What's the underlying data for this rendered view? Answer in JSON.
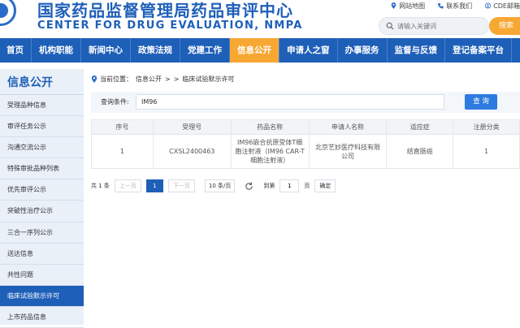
{
  "header": {
    "brand_cn": "国家药品监督管理局药品审评中心",
    "brand_en": "CENTER FOR DRUG EVALUATION, NMPA",
    "toplinks": [
      "网站地图",
      "联系我们",
      "CDE邮箱"
    ],
    "search_placeholder": "请输入关键词",
    "search_button": "搜索"
  },
  "nav": {
    "items": [
      "首页",
      "机构职能",
      "新闻中心",
      "政策法规",
      "党建工作",
      "信息公开",
      "申请人之窗",
      "办事服务",
      "监督与反馈",
      "登记备案平台"
    ],
    "active_index": 5
  },
  "sidebar": {
    "title": "信息公开",
    "items": [
      "受理品种信息",
      "审评任务公示",
      "沟通交流公示",
      "特殊审批品种列表",
      "优先审评公示",
      "突破性治疗公示",
      "三合一序列公示",
      "送达信息",
      "共性问题",
      "临床试验默示许可",
      "上市药品信息"
    ],
    "active_index": 9
  },
  "breadcrumb": {
    "prefix": "当前位置：",
    "parts": [
      "信息公开",
      ">",
      ">",
      "临床试验默示许可"
    ]
  },
  "filter": {
    "label": "查询条件:",
    "value": "IM96",
    "button": "查 询"
  },
  "table": {
    "headers": [
      "序号",
      "受理号",
      "药品名称",
      "申请人名称",
      "适应症",
      "注册分类"
    ],
    "rows": [
      [
        "1",
        "CXSL2400463",
        "IM96嵌合抗原受体T细胞注射液（IM96 CAR-T细胞注射液）",
        "北京艺妙医疗科技有限公司",
        "结直肠癌",
        "1"
      ]
    ]
  },
  "pager": {
    "total": "共 1 条",
    "prev": "上一页",
    "current": "1",
    "next": "下一页",
    "page_size": "10 条/页",
    "goto_label": "到第",
    "goto_value": "1",
    "page_unit": "页",
    "confirm": "确定"
  },
  "colors": {
    "brand_blue": "#1e5fb8",
    "accent_orange": "#f7a833"
  }
}
